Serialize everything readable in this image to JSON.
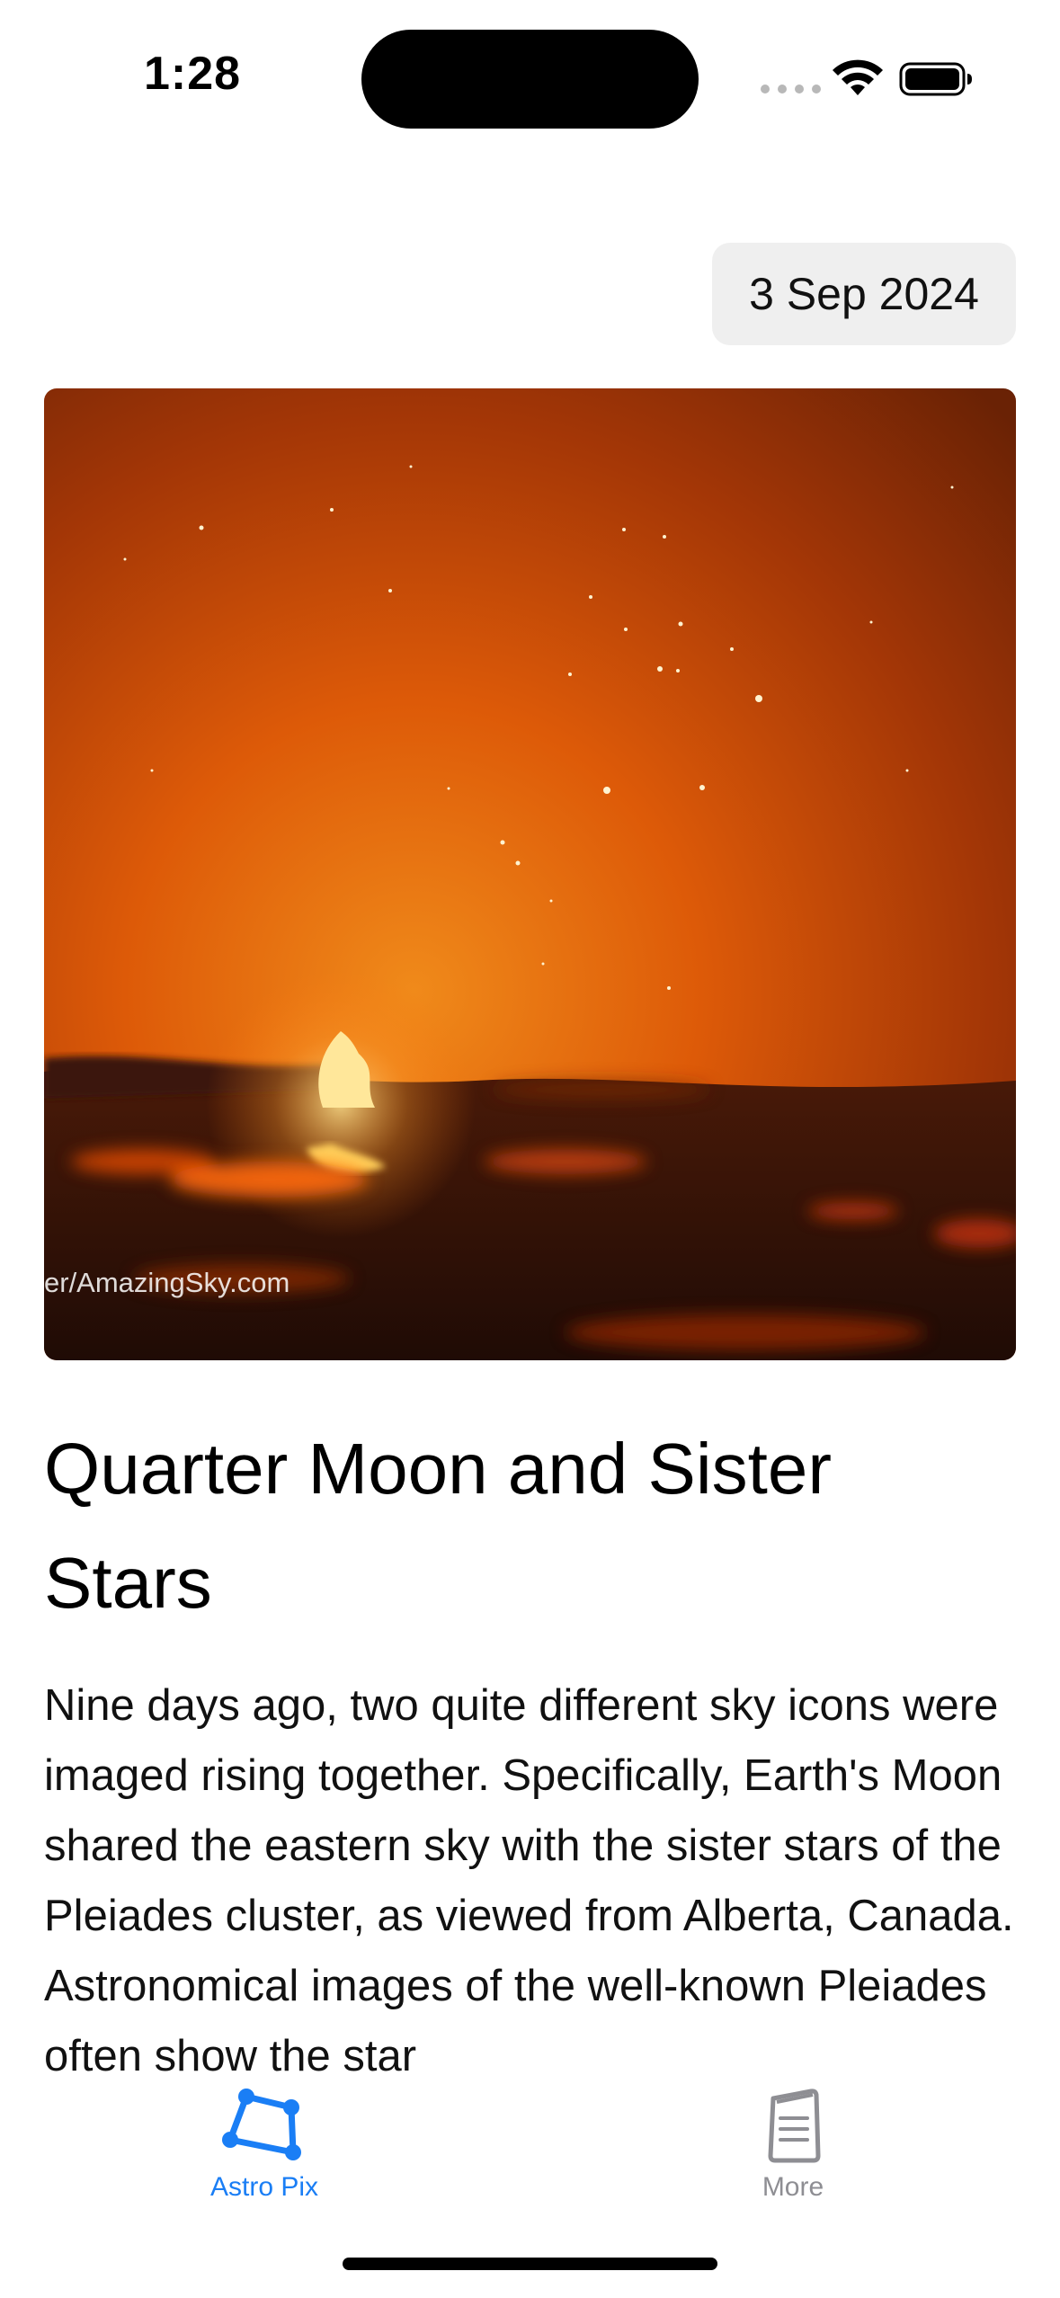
{
  "status_bar": {
    "time": "1:28"
  },
  "date_picker": {
    "value": "3 Sep 2024"
  },
  "apod": {
    "image_credit": "er/AmazingSky.com",
    "title": "Quarter Moon and Sister Stars",
    "explanation": "Nine days ago, two quite different sky icons were imaged rising together. Specifically, Earth's Moon shared the eastern sky with the sister stars of the Pleiades cluster, as viewed from Alberta, Canada.  Astronomical images of the well-known Pleiades often show the star"
  },
  "tab_bar": {
    "tabs": [
      {
        "label": "Astro Pix",
        "icon": "constellation-icon",
        "selected": true
      },
      {
        "label": "More",
        "icon": "document-icon",
        "selected": false
      }
    ],
    "accent_color": "#1a7ef5",
    "inactive_color": "#8e8e93"
  }
}
